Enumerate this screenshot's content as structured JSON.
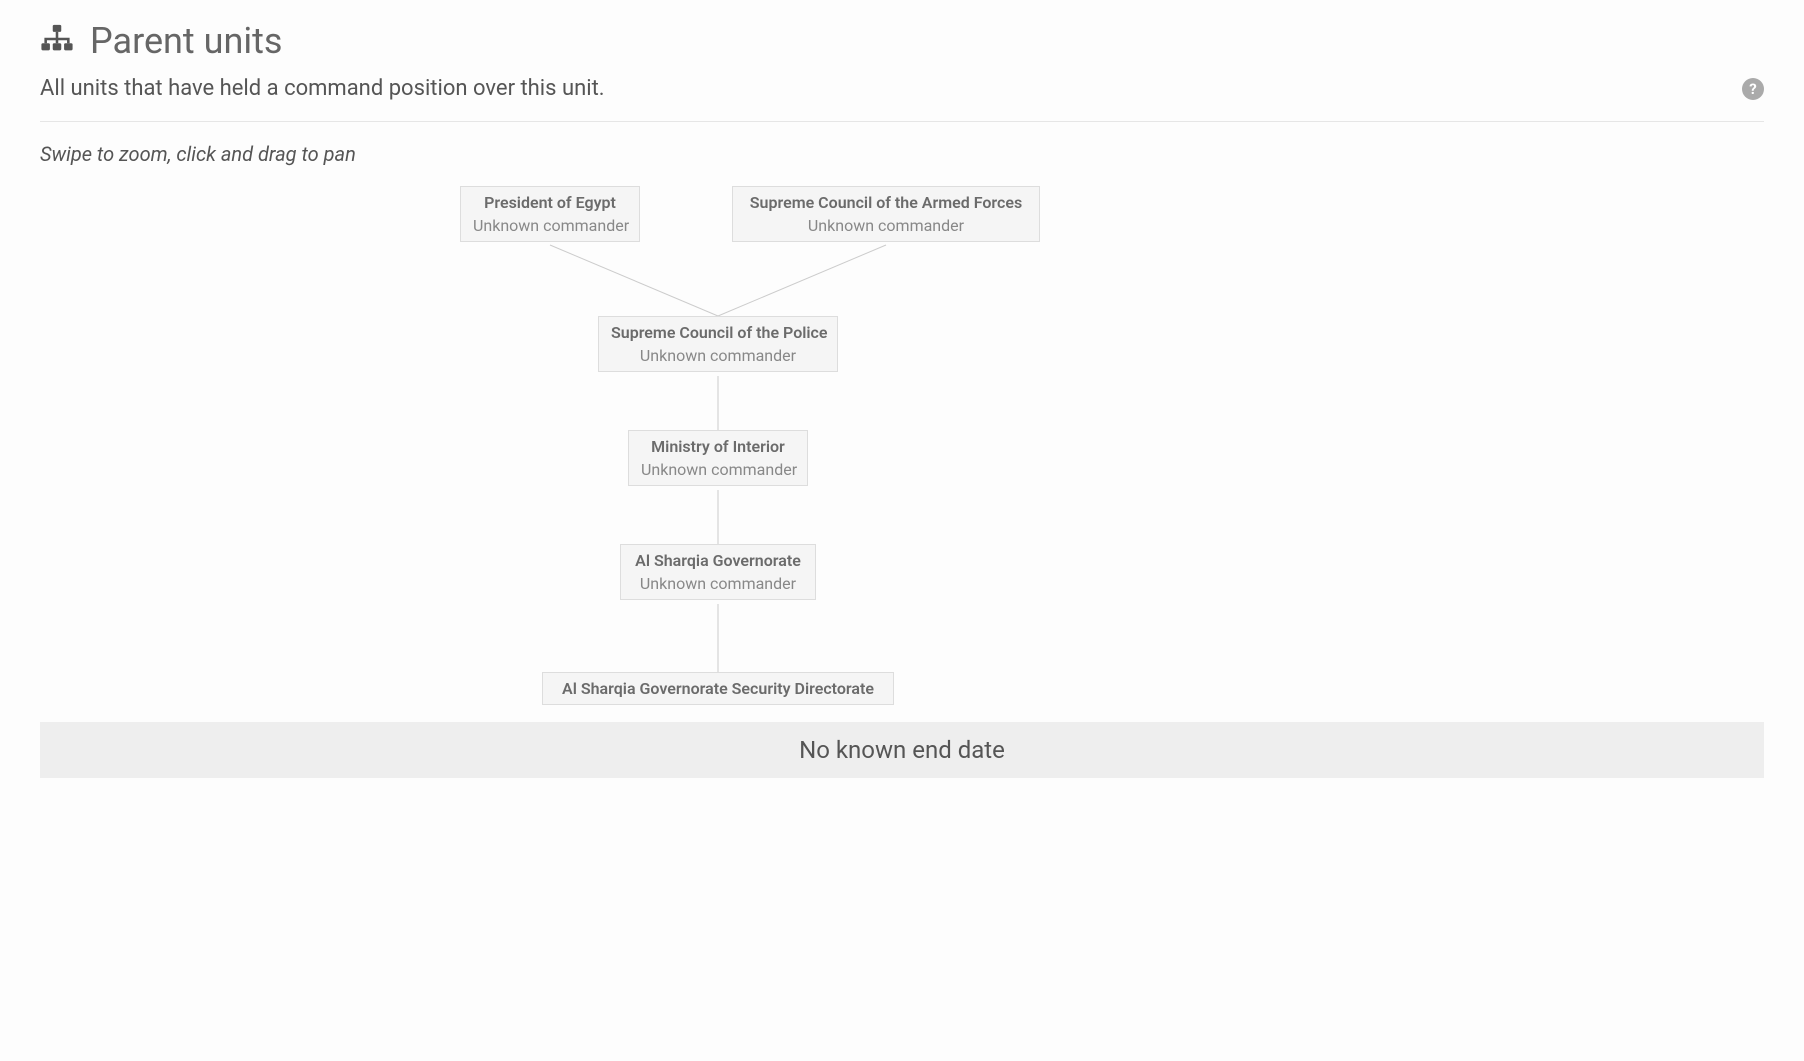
{
  "header": {
    "title": "Parent units",
    "subtitle": "All units that have held a command position over this unit.",
    "instruction": "Swipe to zoom, click and drag to pan"
  },
  "nodes": {
    "n1": {
      "title": "President of Egypt",
      "sub": "Unknown commander"
    },
    "n2": {
      "title": "Supreme Council of the Armed Forces",
      "sub": "Unknown commander"
    },
    "n3": {
      "title": "Supreme Council of the Police",
      "sub": "Unknown commander"
    },
    "n4": {
      "title": "Ministry of Interior",
      "sub": "Unknown commander"
    },
    "n5": {
      "title": "Al Sharqia Governorate",
      "sub": "Unknown commander"
    },
    "n6": {
      "title": "Al Sharqia Governorate Security Directorate"
    }
  },
  "footer": {
    "label": "No known end date"
  }
}
